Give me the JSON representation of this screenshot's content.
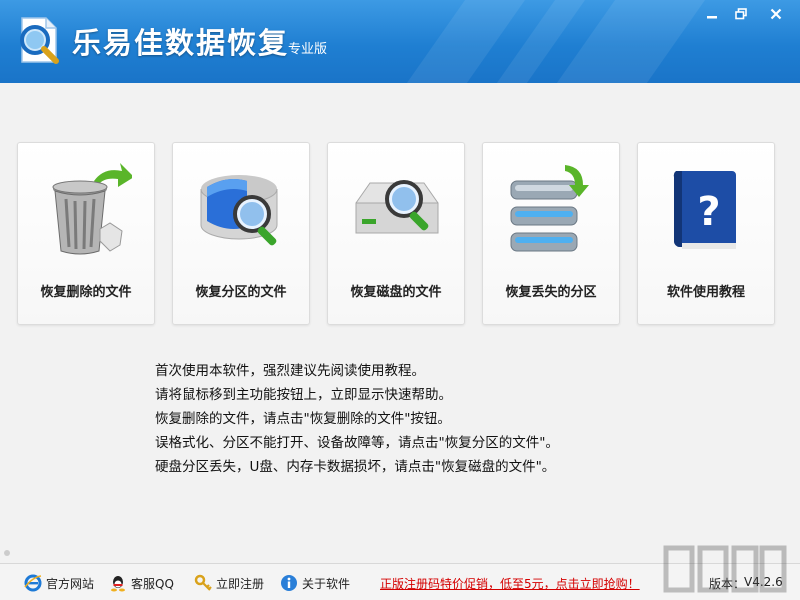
{
  "app": {
    "title": "乐易佳数据恢复",
    "edition": "专业版"
  },
  "window_controls": [
    "minimize",
    "restore",
    "close"
  ],
  "cards": [
    {
      "label": "恢复删除的文件",
      "icon": "recycle-bin-icon"
    },
    {
      "label": "恢复分区的文件",
      "icon": "partition-search-icon"
    },
    {
      "label": "恢复磁盘的文件",
      "icon": "disk-search-icon"
    },
    {
      "label": "恢复丢失的分区",
      "icon": "lost-partition-icon"
    },
    {
      "label": "软件使用教程",
      "icon": "help-book-icon"
    }
  ],
  "help_lines": [
    "首次使用本软件，强烈建议先阅读使用教程。",
    "请将鼠标移到主功能按钮上，立即显示快速帮助。",
    "恢复删除的文件，请点击\"恢复删除的文件\"按钮。",
    "误格式化、分区不能打开、设备故障等，请点击\"恢复分区的文件\"。",
    "硬盘分区丢失，U盘、内存卡数据损坏，请点击\"恢复磁盘的文件\"。"
  ],
  "statusbar": {
    "links": [
      {
        "label": "官方网站",
        "icon": "ie-icon"
      },
      {
        "label": "客服QQ",
        "icon": "qq-icon"
      },
      {
        "label": "立即注册",
        "icon": "key-icon"
      },
      {
        "label": "关于软件",
        "icon": "info-icon"
      }
    ],
    "promo": "正版注册码特价促销，低至5元，点击立即抢购！",
    "version_label": "版本：",
    "version_value": "V4.2.6"
  },
  "colors": {
    "titlebar": "#1f7fd2",
    "promo": "#d40000"
  }
}
